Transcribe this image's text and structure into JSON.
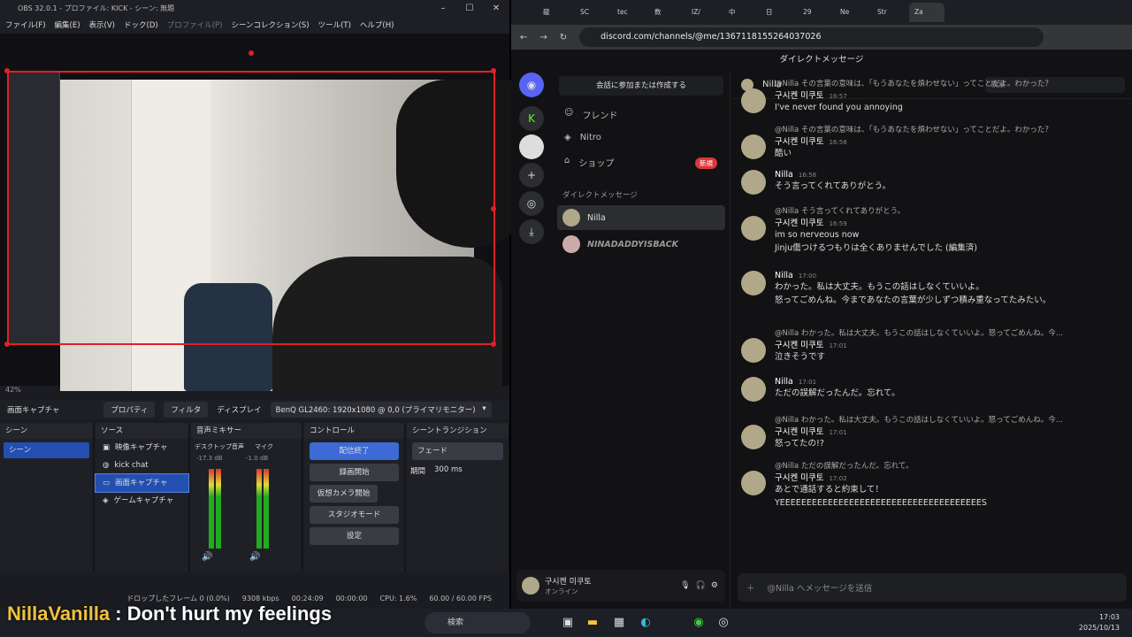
{
  "obs": {
    "title": "OBS 32.0.1 - プロファイル: KICK - シーン: 無題",
    "menu": [
      "ファイル(F)",
      "編集(E)",
      "表示(V)",
      "ドック(D)",
      "プロファイル(P)",
      "シーンコレクション(S)",
      "ツール(T)",
      "ヘルプ(H)"
    ],
    "zoom": "42%",
    "source_name": "画面キャプチャ",
    "properties": "プロパティ",
    "filters": "フィルタ",
    "display_label": "ディスプレイ",
    "display_value": "BenQ GL2460: 1920x1080 @ 0,0 (プライマリモニター)",
    "scenes_title": "シーン",
    "scene_item": "シーン",
    "sources_title": "ソース",
    "sources": [
      "映像キャプチャ",
      "kick chat",
      "画面キャプチャ",
      "ゲームキャプチャ"
    ],
    "mixer_title": "音声ミキサー",
    "desktop_audio": "デスクトップ音声",
    "desktop_db": "-17.3 dB",
    "mic": "マイク",
    "mic_db": "-1.0 dB",
    "controls_title": "コントロール",
    "controls": [
      "配信終了",
      "録画開始",
      "仮想カメラ開始",
      "スタジオモード",
      "設定"
    ],
    "transitions_title": "シーントランジション",
    "transition": "フェード",
    "duration_label": "期間",
    "duration": "300 ms",
    "status": [
      "ドロップしたフレーム 0 (0.0%)",
      "9308 kbps",
      "00:24:09",
      "00:00:00",
      "CPU: 1.6%",
      "60.00 / 60.00 FPS"
    ]
  },
  "chrome": {
    "tabs": [
      "龍",
      "SC",
      "tec",
      "数",
      "IZ/",
      "中",
      "日",
      "29",
      "Ne",
      "Str",
      "Za"
    ],
    "url": "discord.com/channels/@me/1367118155264037026"
  },
  "discord": {
    "top_title": "ダイレクトメッセージ",
    "find_button": "会話に参加または作成する",
    "nav": [
      "フレンド",
      "Nitro",
      "ショップ"
    ],
    "new_badge": "新規",
    "dm_header": "ダイレクトメッセージ",
    "dms": [
      "Nilla",
      "NINADADDYISBACK"
    ],
    "user_name": "구시켄 미쿠토",
    "user_status": "オンライン",
    "channel": "Nilla",
    "search_placeholder": "検索",
    "composer_placeholder": "@Nilla へメッセージを送信",
    "messages": [
      {
        "reply": "@Nilla その言葉の意味は、「もうあなたを煩わせない」ってことだよ。わかった？",
        "author": "구시켄 미쿠토",
        "time": "16:57",
        "lines": [
          "I've never found you annoying"
        ]
      },
      {
        "reply": "@Nilla その言葉の意味は、「もうあなたを煩わせない」ってことだよ。わかった？",
        "author": "구시켄 미쿠토",
        "time": "16:58",
        "lines": [
          "酷い"
        ]
      },
      {
        "reply": "",
        "author": "Nilla",
        "time": "16:58",
        "lines": [
          "そう言ってくれてありがとう。"
        ]
      },
      {
        "reply": "@Nilla そう言ってくれてありがとう。",
        "author": "구시켄 미쿠토",
        "time": "16:59",
        "lines": [
          "im so nerveous now",
          "Jinju傷つけるつもりは全くありませんでした (編集済)"
        ]
      },
      {
        "reply": "",
        "author": "Nilla",
        "time": "17:00",
        "lines": [
          "わかった。私は大丈夫。もうこの話はしなくていいよ。",
          "怒ってごめんね。今まであなたの言葉が少しずつ積み重なってたみたい。"
        ]
      },
      {
        "reply": "@Nilla わかった。私は大丈夫。もうこの話はしなくていいよ。怒ってごめんね。今...",
        "author": "구시켄 미쿠토",
        "time": "17:01",
        "lines": [
          "泣きそうです"
        ]
      },
      {
        "reply": "",
        "author": "Nilla",
        "time": "17:01",
        "lines": [
          "ただの誤解だったんだ。忘れて。"
        ]
      },
      {
        "reply": "@Nilla わかった。私は大丈夫。もうこの話はしなくていいよ。怒ってごめんね。今...",
        "author": "구시켄 미쿠토",
        "time": "17:01",
        "lines": [
          "怒ってたの!?"
        ]
      },
      {
        "reply": "@Nilla ただの誤解だったんだ。忘れて。",
        "author": "구시켄 미쿠토",
        "time": "17:02",
        "lines": [
          "あとで通話すると約束して！",
          "YEEEEEEEEEEEEEEEEEEEEEEEEEEEEEEEEEEEEEES"
        ]
      }
    ]
  },
  "overlay": {
    "name": "NillaVanilla",
    "text": " : Don't hurt my feelings"
  },
  "taskbar": {
    "search": "検索",
    "time": "17:03",
    "date": "2025/10/13"
  }
}
